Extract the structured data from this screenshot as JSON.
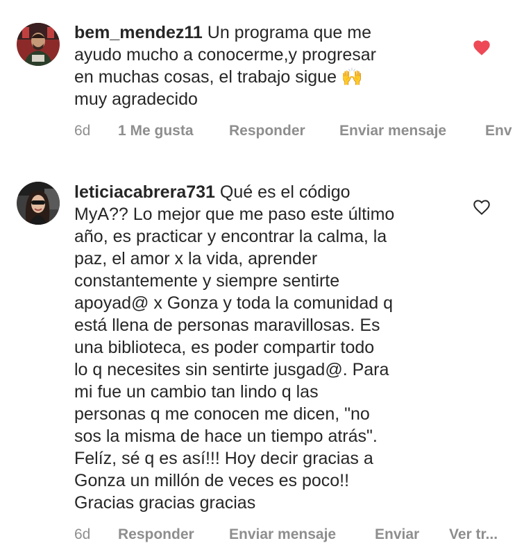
{
  "comments": [
    {
      "username": "bem_mendez11",
      "text": " Un programa que me\nayudo mucho a conocerme,y progresar\nen muchas  cosas, el trabajo sigue 🙌\nmuy agradecido",
      "liked": true,
      "actions": {
        "age": "6d",
        "likes": "1 Me gusta",
        "reply": "Responder",
        "send": "Enviar mensaje",
        "more": "Env"
      }
    },
    {
      "username": "leticiacabrera731",
      "text": " Qué es el código\nMyA?? Lo mejor que me paso este último\naño, es practicar y encontrar la calma, la\npaz, el amor x la vida, aprender\nconstantemente y siempre sentirte\napoyad@ x Gonza y toda la comunidad q\nestá llena de personas maravillosas. Es\nuna biblioteca, es poder compartir todo\nlo q necesites sin sentirte jusgad@. Para\nmi fue un cambio tan lindo q las\npersonas q me conocen me dicen, \"no\nsos la misma de hace un tiempo atrás\".\nFelíz, sé q es así!!! Hoy decir gracias a\nGonza un millón de veces es poco!!\nGracias gracias gracias",
      "liked": false,
      "actions": {
        "age": "6d",
        "reply": "Responder",
        "send": "Enviar mensaje",
        "share": "Enviar",
        "translate": "Ver tr..."
      }
    }
  ],
  "colors": {
    "text": "#262626",
    "secondary": "#8e8e8e",
    "like_red": "#ed4956"
  }
}
